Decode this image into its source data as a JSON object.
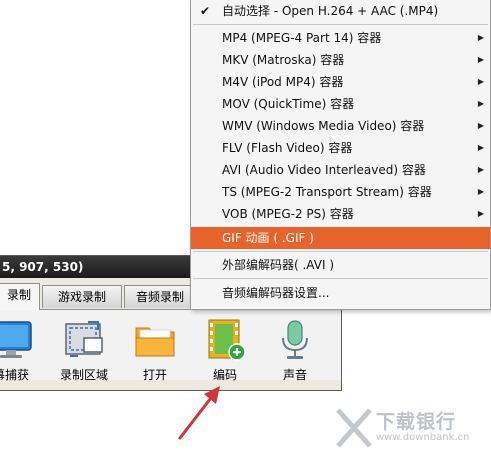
{
  "window": {
    "title": "5, 907, 530)",
    "tabs": [
      {
        "label": "录制",
        "active": true
      },
      {
        "label": "游戏录制",
        "active": false
      },
      {
        "label": "音频录制",
        "active": false
      }
    ],
    "tools": [
      {
        "label": "幕捕获",
        "icon": "monitor-icon"
      },
      {
        "label": "录制区域",
        "icon": "region-select-icon"
      },
      {
        "label": "打开",
        "icon": "folder-icon"
      },
      {
        "label": "编码",
        "icon": "film-plus-icon"
      },
      {
        "label": "声音",
        "icon": "microphone-icon"
      }
    ]
  },
  "menu": {
    "items": [
      {
        "label": "自动选择 - Open H.264 + AAC (.MP4)",
        "checked": true,
        "submenu": false
      },
      {
        "label": "MP4 (MPEG-4 Part 14) 容器",
        "submenu": true
      },
      {
        "label": "MKV (Matroska) 容器",
        "submenu": true
      },
      {
        "label": "M4V (iPod MP4) 容器",
        "submenu": true
      },
      {
        "label": "MOV (QuickTime) 容器",
        "submenu": true
      },
      {
        "label": "WMV (Windows Media Video) 容器",
        "submenu": true
      },
      {
        "label": "FLV (Flash Video) 容器",
        "submenu": true
      },
      {
        "label": "AVI (Audio Video Interleaved) 容器",
        "submenu": true
      },
      {
        "label": "TS (MPEG-2 Transport Stream) 容器",
        "submenu": true
      },
      {
        "label": "VOB (MPEG-2 PS) 容器",
        "submenu": true
      },
      {
        "label": "GIF 动画 ( .GIF )",
        "highlighted": true,
        "submenu": false
      },
      {
        "label": "外部编解码器( .AVI )",
        "submenu": false
      },
      {
        "label": "音频编解码器设置...",
        "submenu": false
      }
    ]
  },
  "watermark": {
    "name": "下载银行",
    "url": "www.downbank.cn"
  },
  "colors": {
    "highlight": "#e8622c",
    "arrow": "#d6323a",
    "titlebar": "#262626"
  }
}
